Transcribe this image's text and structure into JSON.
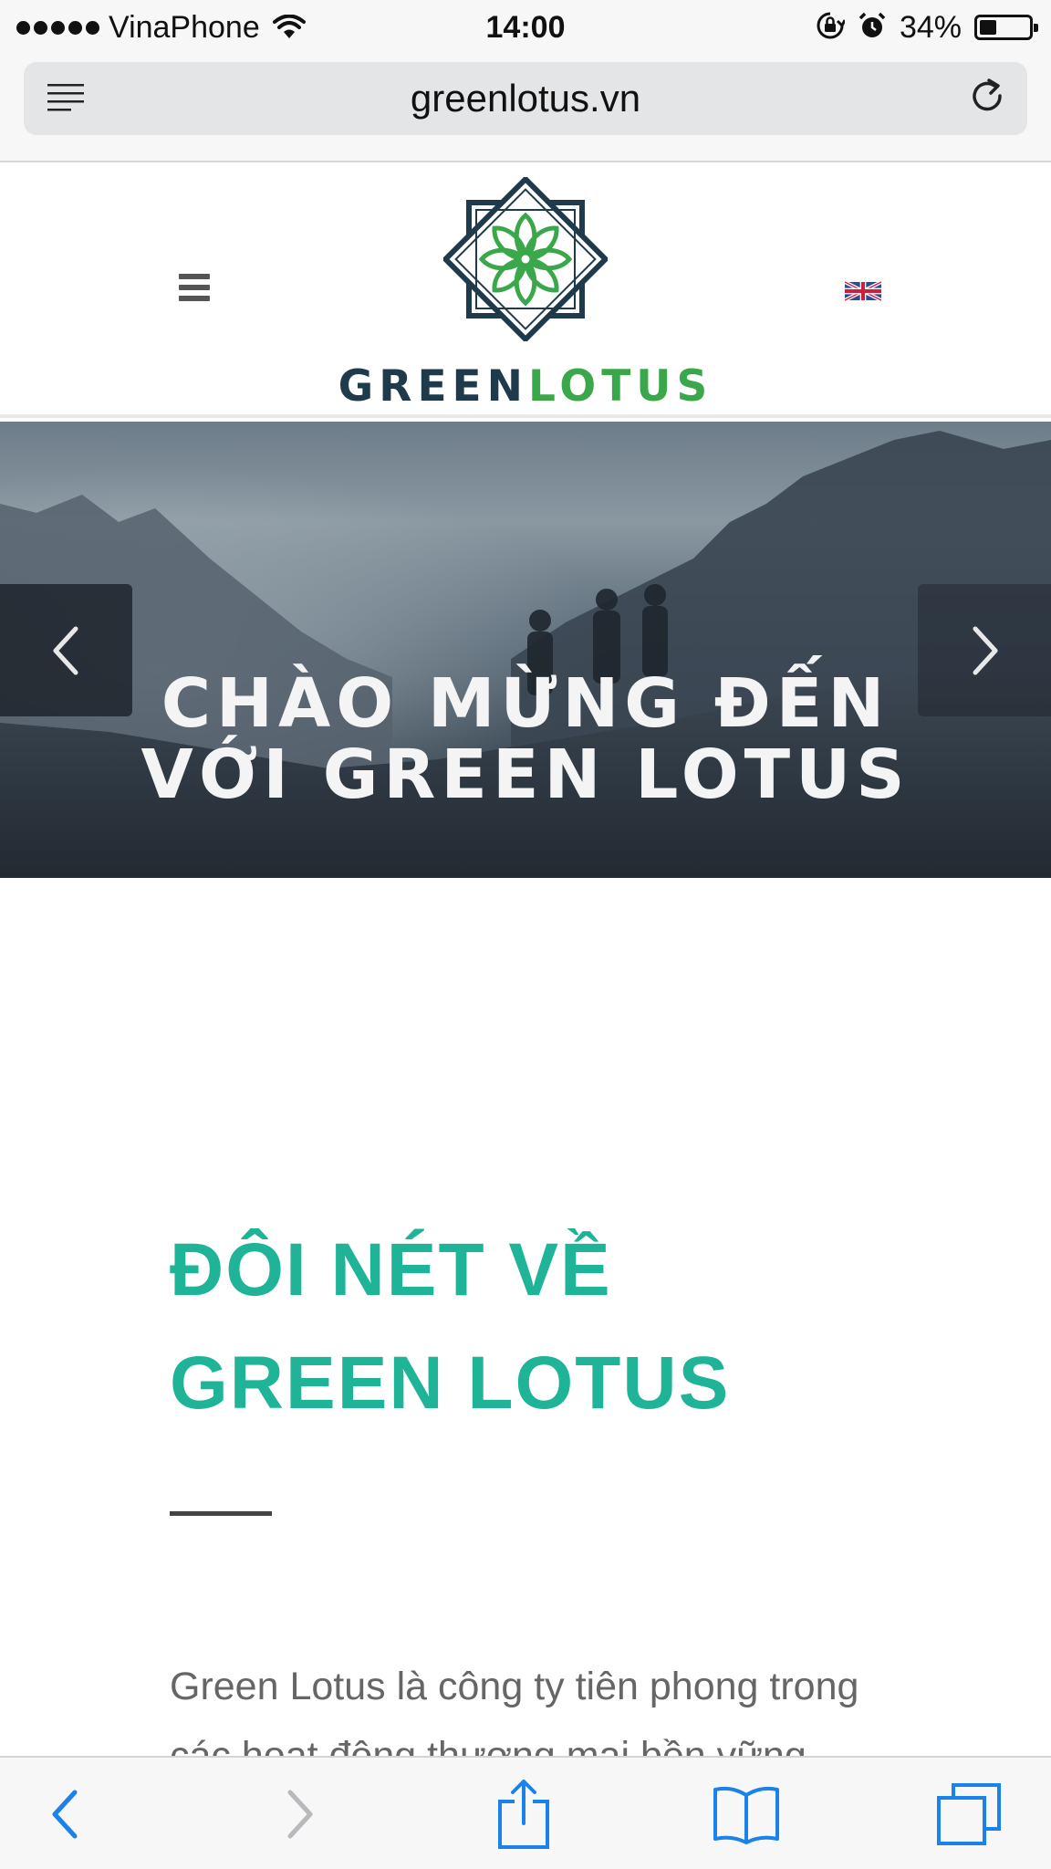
{
  "status_bar": {
    "carrier": "VinaPhone",
    "time": "14:00",
    "battery_percent": "34%",
    "battery_level": 0.34,
    "icons": [
      "signal-dots",
      "wifi-icon",
      "orientation-lock-icon",
      "alarm-icon",
      "battery-icon"
    ]
  },
  "browser": {
    "url": "greenlotus.vn",
    "icons": [
      "reader-icon",
      "reload-icon"
    ]
  },
  "header": {
    "logo_word_1": "GREEN",
    "logo_word_2": "LOTUS",
    "icons": [
      "menu-icon",
      "lotus-logo-icon",
      "uk-flag-icon"
    ]
  },
  "hero": {
    "title": "CHÀO MỪNG ĐẾN VỚI GREEN LOTUS",
    "prev_icon": "chevron-left-icon",
    "next_icon": "chevron-right-icon"
  },
  "about": {
    "heading_line_1": "ĐÔI NÉT VỀ",
    "heading_line_2": "GREEN LOTUS",
    "body": "Green Lotus là công ty tiên phong trong các hoạt động thương mại bền vững"
  },
  "toolbar": {
    "icons": [
      "back-icon",
      "forward-icon",
      "share-icon",
      "bookmarks-icon",
      "tabs-icon"
    ]
  },
  "colors": {
    "accent_teal": "#1fb497",
    "logo_dark": "#1f3a4a",
    "logo_green": "#3aa84a",
    "ios_blue": "#1a82e8"
  }
}
